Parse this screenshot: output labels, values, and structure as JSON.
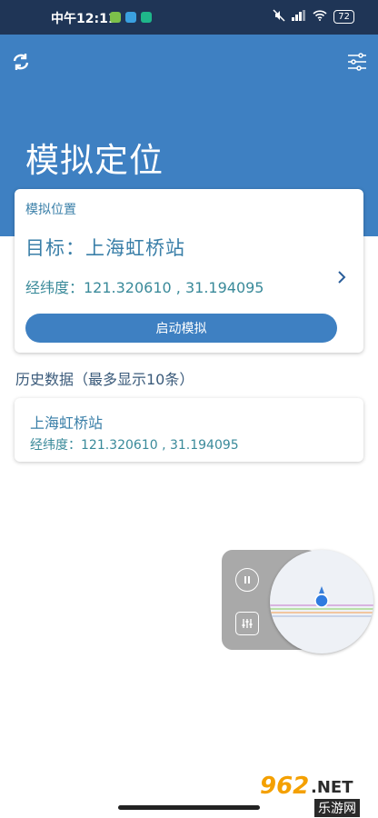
{
  "status_bar": {
    "time": "中午12:11",
    "battery": "72"
  },
  "header": {
    "title": "模拟定位",
    "refresh_icon": "refresh-icon",
    "filter_icon": "filter-sliders-icon"
  },
  "current": {
    "section_label": "模拟位置",
    "target": "目标：上海虹桥站",
    "coords": "经纬度：121.320610 , 31.194095",
    "start_button": "启动模拟"
  },
  "history": {
    "title": "历史数据（最多显示10条）",
    "items": [
      {
        "name": "上海虹桥站",
        "coords": "经纬度：121.320610 , 31.194095"
      }
    ]
  },
  "float_widget": {
    "pause_icon": "pause-icon",
    "adjust_icon": "adjust-sliders-icon",
    "map_pin_icon": "location-pin-icon"
  },
  "watermark": {
    "number": "962",
    "suffix": ".NET",
    "text": "乐游网"
  },
  "colors": {
    "primary": "#3e80c2",
    "status_bar": "#1f3556",
    "text_accent": "#3a7fa8"
  }
}
